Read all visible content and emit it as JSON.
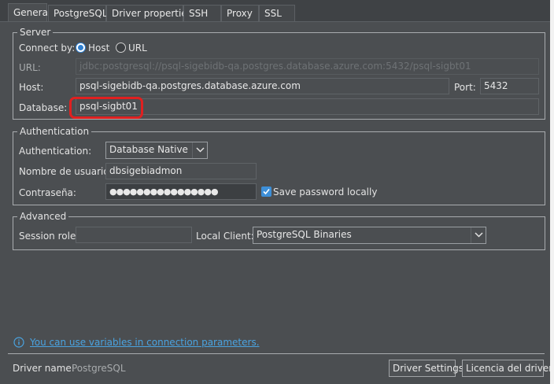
{
  "tabs": [
    {
      "label": "General"
    },
    {
      "label": "PostgreSQL"
    },
    {
      "label": "Driver properties"
    },
    {
      "label": "SSH"
    },
    {
      "label": "Proxy"
    },
    {
      "label": "SSL"
    }
  ],
  "server": {
    "legend": "Server",
    "connect_by_label": "Connect by:",
    "host_option": "Host",
    "url_option": "URL",
    "selected": "Host",
    "url_label": "URL:",
    "url_value": "jdbc:postgresql://psql-sigebidb-qa.postgres.database.azure.com:5432/psql-sigbt01",
    "host_label": "Host:",
    "host_value": "psql-sigebidb-qa.postgres.database.azure.com",
    "port_label": "Port:",
    "port_value": "5432",
    "database_label": "Database:",
    "database_value": "psql-sigbt01"
  },
  "authentication": {
    "legend": "Authentication",
    "auth_label": "Authentication:",
    "auth_value": "Database Native",
    "user_label": "Nombre de usuario:",
    "user_value": "dbsigebiadmon",
    "password_label": "Contraseña:",
    "password_value": "●●●●●●●●●●●●●●●●",
    "save_password_label": "Save password locally",
    "save_password_checked": true
  },
  "advanced": {
    "legend": "Advanced",
    "session_role_label": "Session role:",
    "session_role_value": "",
    "local_client_label": "Local Client:",
    "local_client_value": "PostgreSQL Binaries"
  },
  "footer": {
    "variables_link": "You can use variables in connection parameters.",
    "driver_name_label": "Driver name:",
    "driver_name_value": "PostgreSQL",
    "driver_settings_button": "Driver Settings",
    "license_button": "Licencia del driver"
  },
  "colors": {
    "background": "#4b4e51",
    "accent": "#2f7fd0",
    "link": "#4aa3e0",
    "highlight": "#e02020"
  }
}
